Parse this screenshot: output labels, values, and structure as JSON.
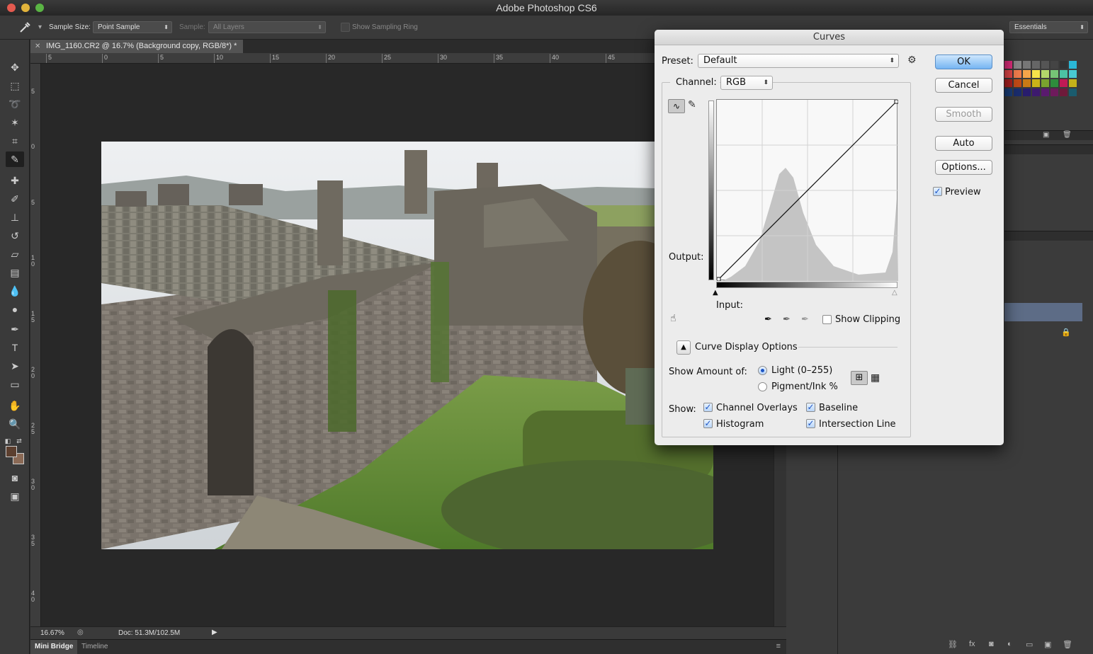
{
  "app": {
    "title": "Adobe Photoshop CS6"
  },
  "options_bar": {
    "sample_size_label": "Sample Size:",
    "sample_size_value": "Point Sample",
    "sample_label": "Sample:",
    "sample_value": "All Layers",
    "show_sampling_ring": "Show Sampling Ring",
    "workspace": "Essentials"
  },
  "document": {
    "tab_title": "IMG_1160.CR2 @ 16.7% (Background copy, RGB/8*) *",
    "zoom": "16.67%",
    "doc_info": "Doc: 51.3M/102.5M",
    "ruler_top": [
      "5",
      "0",
      "5",
      "10",
      "15",
      "20",
      "25",
      "30",
      "35",
      "40",
      "45"
    ],
    "ruler_left": [
      "5",
      "0",
      "5",
      "1 0",
      "1 5",
      "2 0",
      "2 5",
      "3 0",
      "3 5",
      "4 0"
    ]
  },
  "bottom_tabs": [
    "Mini Bridge",
    "Timeline"
  ],
  "curves": {
    "title": "Curves",
    "preset_label": "Preset:",
    "preset_value": "Default",
    "channel_label": "Channel:",
    "channel_value": "RGB",
    "output_label": "Output:",
    "input_label": "Input:",
    "show_clipping": "Show Clipping",
    "display_options": "Curve Display Options",
    "show_amount_label": "Show Amount of:",
    "light_option": "Light  (0–255)",
    "pigment_option": "Pigment/Ink %",
    "show_label": "Show:",
    "channel_overlays": "Channel Overlays",
    "baseline": "Baseline",
    "histogram": "Histogram",
    "intersection_line": "Intersection Line",
    "buttons": {
      "ok": "OK",
      "cancel": "Cancel",
      "smooth": "Smooth",
      "auto": "Auto",
      "options": "Options..."
    },
    "preview": "Preview"
  }
}
